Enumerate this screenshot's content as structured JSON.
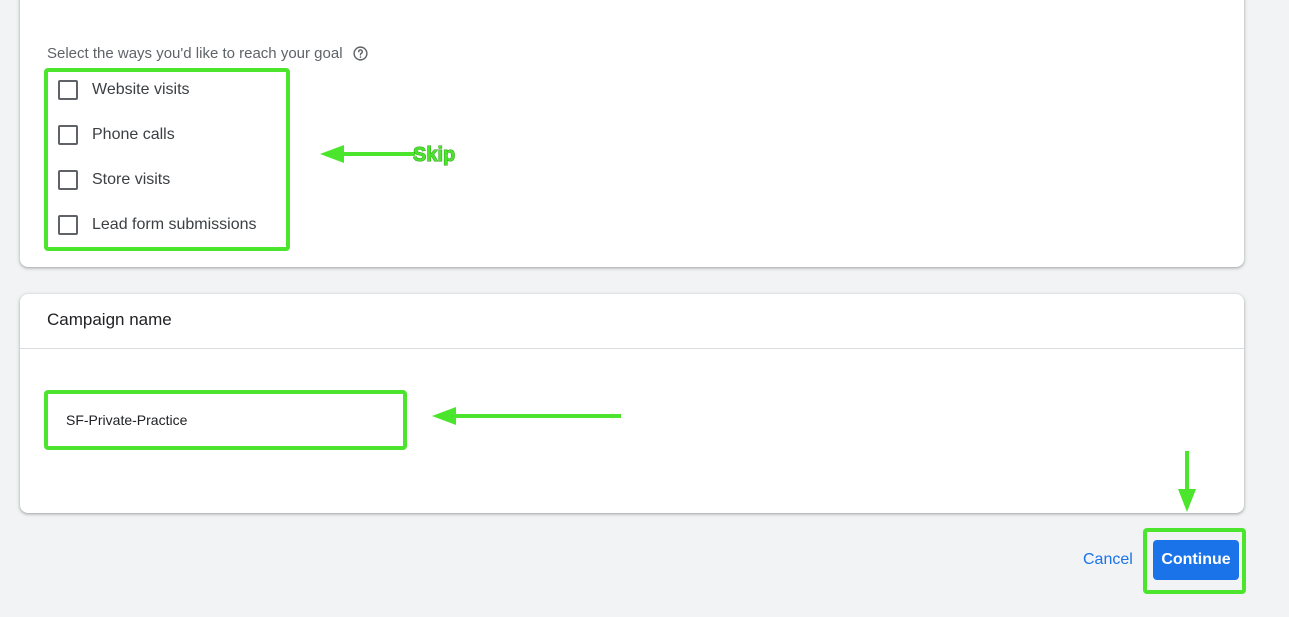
{
  "goal_section": {
    "prompt": "Select the ways you'd like to reach your goal",
    "help_icon": "help-circle-icon",
    "options": [
      {
        "label": "Website visits",
        "checked": false
      },
      {
        "label": "Phone calls",
        "checked": false
      },
      {
        "label": "Store visits",
        "checked": false
      },
      {
        "label": "Lead form submissions",
        "checked": false
      }
    ]
  },
  "campaign_section": {
    "title": "Campaign name",
    "name_value": "SF-Private-Practice"
  },
  "actions": {
    "cancel_label": "Cancel",
    "continue_label": "Continue"
  },
  "annotations": {
    "skip_label": "Skip",
    "color": "#4be52e"
  },
  "colors": {
    "page_background": "#f1f3f4",
    "primary": "#1a73e8"
  }
}
